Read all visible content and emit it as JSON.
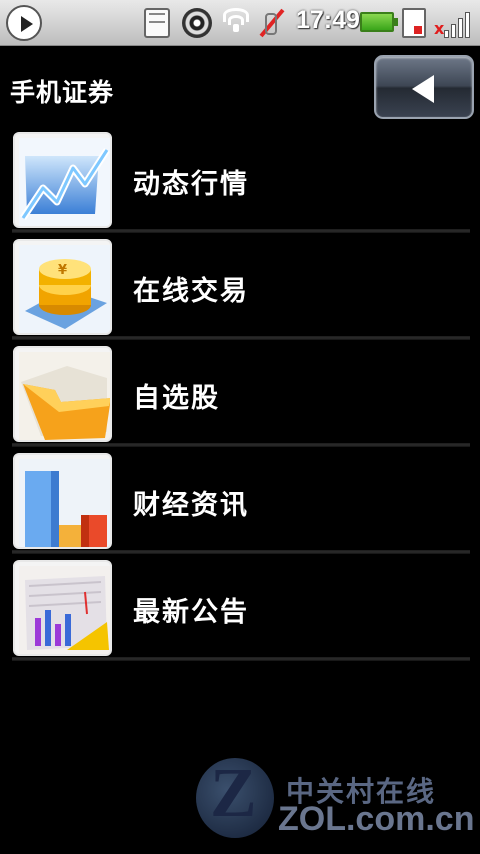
{
  "status_bar": {
    "time": "17:49",
    "icons": [
      "play-icon",
      "sd-card-icon",
      "disc-icon",
      "wifi-icon",
      "notification-off-icon",
      "battery-icon",
      "sim-card-icon",
      "signal-icon"
    ]
  },
  "header": {
    "title": "手机证券",
    "back_icon": "back-arrow-icon"
  },
  "menu": {
    "items": [
      {
        "label": "动态行情",
        "icon": "market-chart-icon"
      },
      {
        "label": "在线交易",
        "icon": "coins-icon"
      },
      {
        "label": "自选股",
        "icon": "folder-icon"
      },
      {
        "label": "财经资讯",
        "icon": "bar-chart-icon"
      },
      {
        "label": "最新公告",
        "icon": "announcement-icon"
      }
    ]
  },
  "watermark": {
    "cn": "中关村在线",
    "en": "ZOL.com.cn"
  },
  "colors": {
    "background": "#000000",
    "status_bar": "#d8d8d8",
    "back_button": "#3d4654",
    "label": "#ffffff"
  }
}
